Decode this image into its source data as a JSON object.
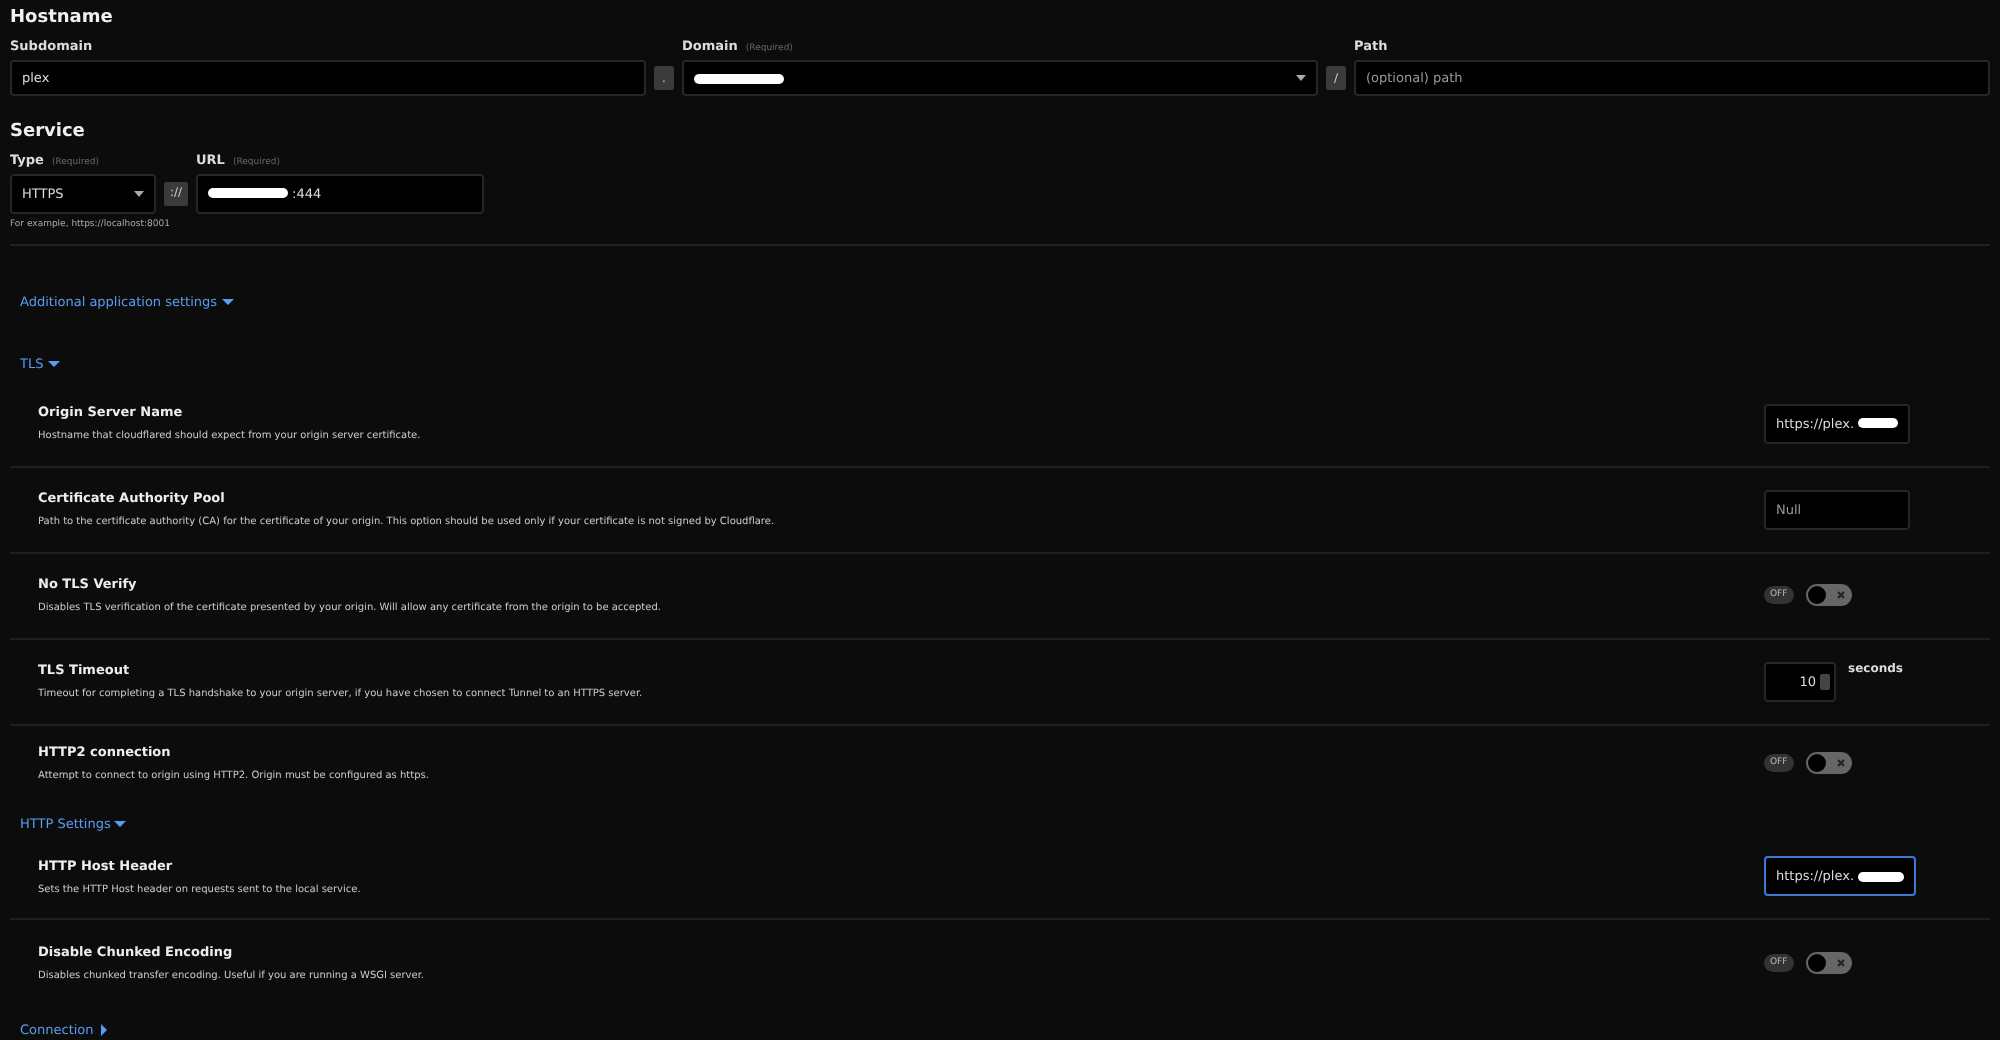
{
  "hostname": {
    "title": "Hostname",
    "subdomain": {
      "label": "Subdomain",
      "value": "plex"
    },
    "separator": ".",
    "domain": {
      "label": "Domain",
      "required": "(Required)"
    },
    "path_separator": "/",
    "path": {
      "label": "Path",
      "placeholder": "(optional) path"
    }
  },
  "service": {
    "title": "Service",
    "type": {
      "label": "Type",
      "required": "(Required)",
      "value": "HTTPS"
    },
    "scheme_separator": "://",
    "url": {
      "label": "URL",
      "required": "(Required)",
      "value": ":444"
    },
    "hint": "For example, https://localhost:8001"
  },
  "additional": {
    "label": "Additional application settings",
    "expanded": true
  },
  "sections": [
    {
      "label": "TLS",
      "expanded": true,
      "rows": [
        {
          "kind": "text",
          "title": "Origin Server Name",
          "description": "Hostname that cloudflared should expect from your origin server certificate.",
          "value": "https://plex.",
          "focused": false
        },
        {
          "kind": "text",
          "title": "Certificate Authority Pool",
          "description": "Path to the certificate authority (CA) for the certificate of your origin. This option should be used only if your certificate is not signed by Cloudflare.",
          "placeholder": "Null",
          "focused": false
        },
        {
          "kind": "toggle",
          "title": "No TLS Verify",
          "description": "Disables TLS verification of the certificate presented by your origin. Will allow any certificate from the origin to be accepted.",
          "on": false,
          "state_label": "OFF"
        },
        {
          "kind": "number",
          "title": "TLS Timeout",
          "description": "Timeout for completing a TLS handshake to your origin server, if you have chosen to connect Tunnel to an HTTPS server.",
          "value": "10",
          "unit": "seconds"
        },
        {
          "kind": "toggle",
          "title": "HTTP2 connection",
          "description": "Attempt to connect to origin using HTTP2. Origin must be configured as https.",
          "on": false,
          "state_label": "OFF"
        }
      ]
    },
    {
      "label": "HTTP Settings",
      "expanded": true,
      "rows": [
        {
          "kind": "text",
          "title": "HTTP Host Header",
          "description": "Sets the HTTP Host header on requests sent to the local service.",
          "value": "https://plex.",
          "focused": true
        },
        {
          "kind": "toggle",
          "title": "Disable Chunked Encoding",
          "description": "Disables chunked transfer encoding. Useful if you are running a WSGI server.",
          "on": false,
          "state_label": "OFF"
        }
      ]
    },
    {
      "label": "Connection",
      "expanded": false
    }
  ]
}
